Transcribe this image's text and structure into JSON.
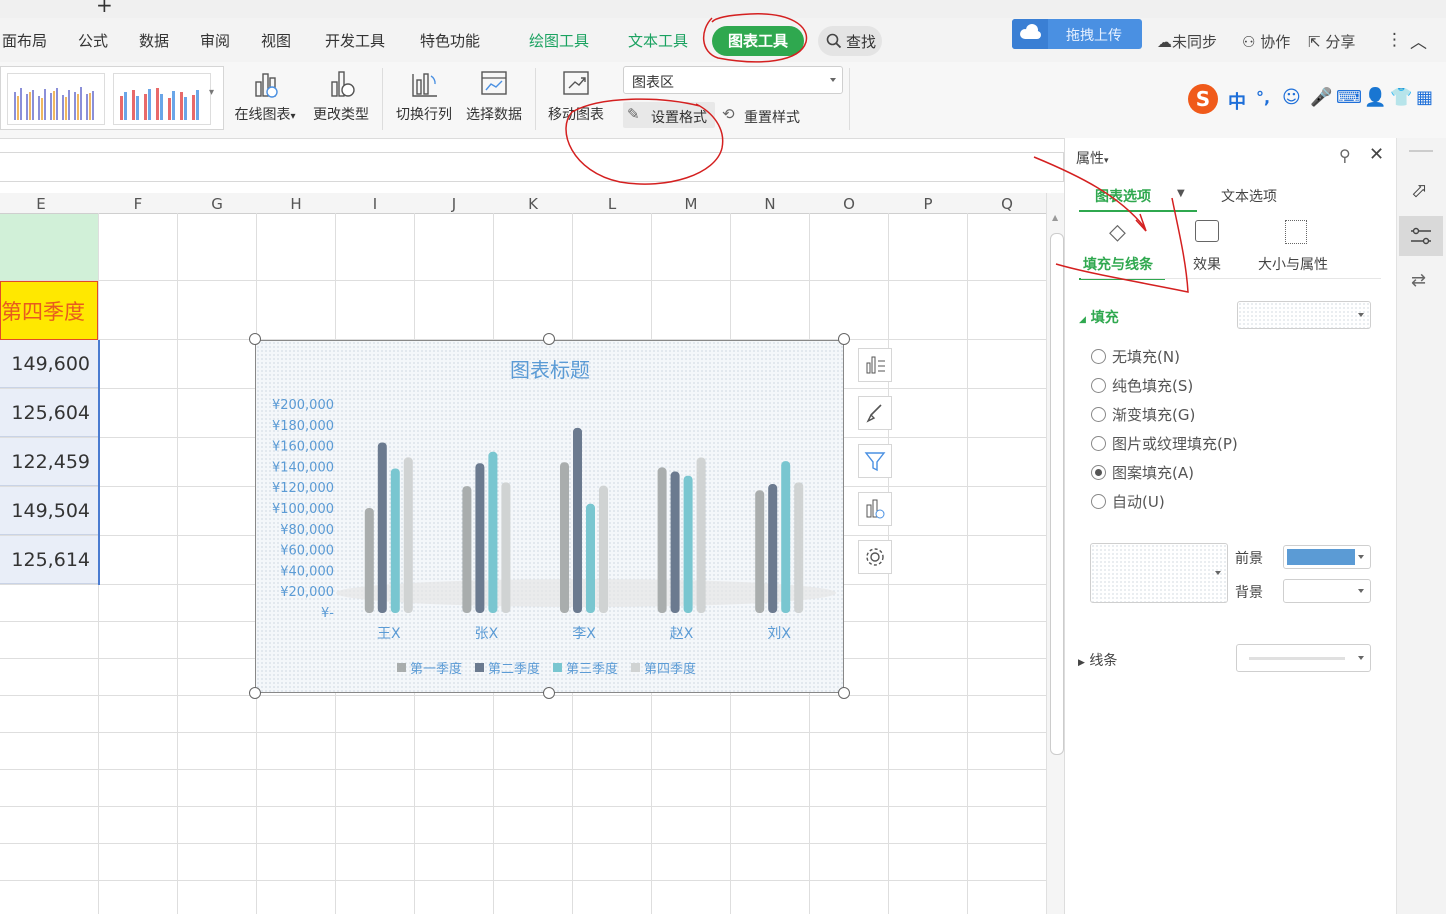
{
  "ribbon_tabs": [
    "面布局",
    "公式",
    "数据",
    "审阅",
    "视图",
    "开发工具",
    "特色功能"
  ],
  "context_tabs": {
    "drawing_tools": "绘图工具",
    "text_tools": "文本工具",
    "chart_tools": "图表工具"
  },
  "search_label": "查找",
  "top_right": {
    "upload": "拖拽上传",
    "sync": "未同步",
    "collab": "协作",
    "share": "分享"
  },
  "ime": {
    "lang": "中",
    "punct": "°,"
  },
  "ribbon_buttons": {
    "online_chart": "在线图表",
    "change_type": "更改类型",
    "switch_rowcol": "切换行列",
    "select_data": "选择数据",
    "move_chart": "移动图表",
    "set_format": "设置格式",
    "reset_style": "重置样式",
    "element_select": "图表区"
  },
  "columns": [
    "E",
    "F",
    "G",
    "H",
    "I",
    "J",
    "K",
    "L",
    "M",
    "N",
    "O",
    "P",
    "Q"
  ],
  "column_e": {
    "header": "第四季度",
    "values": [
      "149,600",
      "125,604",
      "122,459",
      "149,504",
      "125,614"
    ]
  },
  "chart_data": {
    "type": "bar",
    "title": "图表标题",
    "categories": [
      "王X",
      "张X",
      "李X",
      "赵X",
      "刘X"
    ],
    "series": [
      {
        "name": "第一季度",
        "color": "#a9adad",
        "values": [
          101000,
          122000,
          145000,
          140000,
          118000
        ]
      },
      {
        "name": "第二季度",
        "color": "#6b7a8f",
        "values": [
          164000,
          144000,
          178000,
          136000,
          124000
        ]
      },
      {
        "name": "第三季度",
        "color": "#79c6d0",
        "values": [
          139000,
          155000,
          105000,
          132000,
          146000
        ]
      },
      {
        "name": "第四季度",
        "color": "#d0d3d3",
        "values": [
          149600,
          125604,
          122459,
          149504,
          125614
        ]
      }
    ],
    "ylim": [
      0,
      200000
    ],
    "yticks": [
      "¥-",
      "¥20,000",
      "¥40,000",
      "¥60,000",
      "¥80,000",
      "¥100,000",
      "¥120,000",
      "¥140,000",
      "¥160,000",
      "¥180,000",
      "¥200,000"
    ],
    "legend": "bottom",
    "grid": false
  },
  "panel": {
    "title": "属性",
    "tabs": [
      "图表选项",
      "文本选项"
    ],
    "subtabs": [
      "填充与线条",
      "效果",
      "大小与属性"
    ],
    "fill_section": "填充",
    "fill_options": [
      "无填充(N)",
      "纯色填充(S)",
      "渐变填充(G)",
      "图片或纹理填充(P)",
      "图案填充(A)",
      "自动(U)"
    ],
    "selected_option": "图案填充(A)",
    "foreground_label": "前景",
    "background_label": "背景",
    "foreground_color": "#5b9bd5",
    "line_section": "线条"
  },
  "accent_color": "#2fa84f"
}
